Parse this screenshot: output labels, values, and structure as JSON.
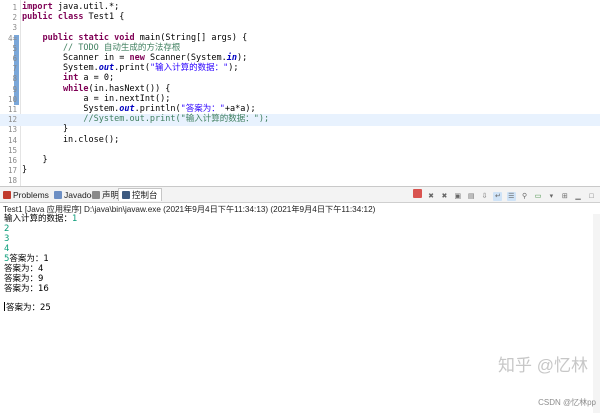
{
  "editor": {
    "lines": [
      {
        "num": "1",
        "parts": [
          {
            "t": "import",
            "c": "kw"
          },
          {
            "t": " java.util.*;",
            "c": ""
          }
        ]
      },
      {
        "num": "2",
        "parts": [
          {
            "t": "public",
            "c": "kw"
          },
          {
            "t": " ",
            "c": ""
          },
          {
            "t": "class",
            "c": "kw"
          },
          {
            "t": " Test1 {",
            "c": ""
          }
        ]
      },
      {
        "num": "3",
        "parts": []
      },
      {
        "num": "4=",
        "parts": [
          {
            "t": "    ",
            "c": ""
          },
          {
            "t": "public",
            "c": "kw"
          },
          {
            "t": " ",
            "c": ""
          },
          {
            "t": "static",
            "c": "kw"
          },
          {
            "t": " ",
            "c": ""
          },
          {
            "t": "void",
            "c": "kw"
          },
          {
            "t": " main(String[] args) {",
            "c": ""
          }
        ]
      },
      {
        "num": "5",
        "parts": [
          {
            "t": "        // TODO 自动生成的方法存根",
            "c": "cm"
          }
        ]
      },
      {
        "num": "6",
        "parts": [
          {
            "t": "        Scanner in = ",
            "c": ""
          },
          {
            "t": "new",
            "c": "kw"
          },
          {
            "t": " Scanner(System.",
            "c": ""
          },
          {
            "t": "in",
            "c": "fld"
          },
          {
            "t": ");",
            "c": ""
          }
        ]
      },
      {
        "num": "7",
        "parts": [
          {
            "t": "        System.",
            "c": ""
          },
          {
            "t": "out",
            "c": "fld"
          },
          {
            "t": ".print(",
            "c": ""
          },
          {
            "t": "\"输入计算的数据：\"",
            "c": "st"
          },
          {
            "t": ");",
            "c": ""
          }
        ]
      },
      {
        "num": "8",
        "parts": [
          {
            "t": "        ",
            "c": ""
          },
          {
            "t": "int",
            "c": "kw"
          },
          {
            "t": " a = 0;",
            "c": ""
          }
        ]
      },
      {
        "num": "9",
        "parts": [
          {
            "t": "        ",
            "c": ""
          },
          {
            "t": "while",
            "c": "kw"
          },
          {
            "t": "(in.hasNext()) {",
            "c": ""
          }
        ]
      },
      {
        "num": "10",
        "parts": [
          {
            "t": "            a = in.nextInt();",
            "c": ""
          }
        ]
      },
      {
        "num": "11",
        "parts": [
          {
            "t": "            System.",
            "c": ""
          },
          {
            "t": "out",
            "c": "fld"
          },
          {
            "t": ".println(",
            "c": ""
          },
          {
            "t": "\"答案为：\"",
            "c": "st"
          },
          {
            "t": "+a*a);",
            "c": ""
          }
        ]
      },
      {
        "num": "12",
        "parts": [
          {
            "t": "            //System.out.print(\"输入计算的数据：\");",
            "c": "cm"
          }
        ],
        "hl": true
      },
      {
        "num": "13",
        "parts": [
          {
            "t": "        }",
            "c": ""
          }
        ]
      },
      {
        "num": "14",
        "parts": [
          {
            "t": "        in.close();",
            "c": ""
          }
        ]
      },
      {
        "num": "15",
        "parts": []
      },
      {
        "num": "16",
        "parts": [
          {
            "t": "    }",
            "c": ""
          }
        ]
      },
      {
        "num": "17",
        "parts": [
          {
            "t": "}",
            "c": ""
          }
        ]
      },
      {
        "num": "18",
        "parts": []
      }
    ]
  },
  "tabs": {
    "problems": "Problems",
    "javadoc": "Javadoc",
    "declaration": "声明",
    "console": "控制台"
  },
  "console": {
    "title": "Test1 [Java 应用程序] D:\\java\\bin\\javaw.exe  (2021年9月4日下午11:34:13)   (2021年9月4日下午11:34:12)",
    "prompt": "输入计算的数据：",
    "first_input": "1",
    "inputs": [
      "2",
      "3",
      "4"
    ],
    "line5_input": "5",
    "answers": [
      "答案为：1",
      "答案为：4",
      "答案为：9",
      "答案为：16"
    ],
    "last_answer": "答案为：25"
  },
  "watermark": {
    "main": "知乎 @忆林",
    "sub": "CSDN @忆林pp"
  },
  "colors": {
    "keyword": "#7f0055",
    "comment": "#3f7f5f",
    "string": "#2a00ff",
    "field": "#0000c0",
    "user_input": "#0a9c79"
  }
}
